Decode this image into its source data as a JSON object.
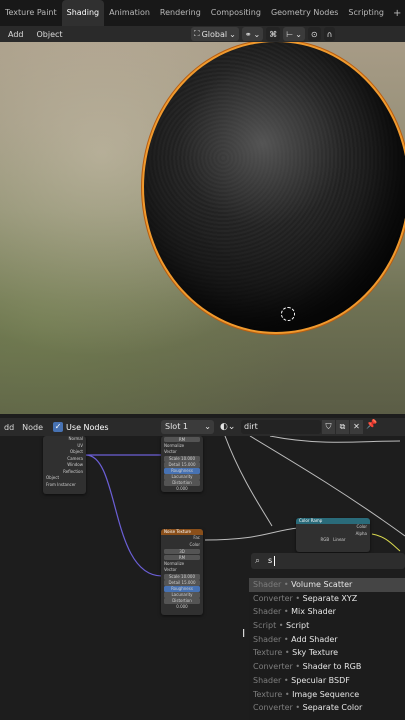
{
  "workspace_tabs": [
    {
      "label": "Texture Paint",
      "active": false
    },
    {
      "label": "Shading",
      "active": true
    },
    {
      "label": "Animation",
      "active": false
    },
    {
      "label": "Rendering",
      "active": false
    },
    {
      "label": "Compositing",
      "active": false
    },
    {
      "label": "Geometry Nodes",
      "active": false
    },
    {
      "label": "Scripting",
      "active": false
    }
  ],
  "add_tab_symbol": "+",
  "viewport_header": {
    "menus": [
      "Add",
      "Object"
    ],
    "orientation": "Global"
  },
  "node_editor_header": {
    "menus": [
      "dd",
      "Node"
    ],
    "use_nodes_label": "Use Nodes",
    "slot": "Slot 1",
    "material_name": "dirt"
  },
  "nodes": {
    "texcoord": {
      "outputs": [
        "Normal",
        "UV",
        "Object",
        "Camera",
        "Window",
        "Reflection"
      ],
      "object_label": "Object",
      "from_instancer": "From Instancer"
    },
    "noise_top": {
      "title": "RM",
      "normalize": "Normalize",
      "vector": "Vector",
      "fields": [
        "Scale 10.000",
        "Detail 15.000",
        "Roughness 0.800",
        "Lacunarity 2.000",
        "Distortion 0.000"
      ]
    },
    "voronoi": {
      "title": "Noise Texture",
      "outputs": [
        "Fac",
        "Color"
      ],
      "dims": "3D",
      "type": "RM",
      "normalize": "Normalize",
      "vector": "Vector",
      "fields": [
        "Scale 10.000",
        "Detail 15.000",
        "Roughness 0.800",
        "Lacunarity 2.000",
        "Distortion 0.000"
      ]
    },
    "colorramp": {
      "title": "Color Ramp",
      "outputs": [
        "Color",
        "Alpha"
      ],
      "mode": "RGB",
      "interp": "Linear"
    }
  },
  "search": {
    "query": "s"
  },
  "search_results": [
    {
      "category": "Shader",
      "name": "Volume Scatter",
      "highlighted": true
    },
    {
      "category": "Converter",
      "name": "Separate XYZ",
      "highlighted": false
    },
    {
      "category": "Shader",
      "name": "Mix Shader",
      "highlighted": false
    },
    {
      "category": "Script",
      "name": "Script",
      "highlighted": false
    },
    {
      "category": "Shader",
      "name": "Add Shader",
      "highlighted": false
    },
    {
      "category": "Texture",
      "name": "Sky Texture",
      "highlighted": false
    },
    {
      "category": "Converter",
      "name": "Shader to RGB",
      "highlighted": false
    },
    {
      "category": "Shader",
      "name": "Specular BSDF",
      "highlighted": false
    },
    {
      "category": "Texture",
      "name": "Image Sequence",
      "highlighted": false
    },
    {
      "category": "Converter",
      "name": "Separate Color",
      "highlighted": false
    }
  ],
  "colors": {
    "selection_outline": "#f09a2e",
    "accent_blue": "#4772b3",
    "texture_header": "#8a4f1a",
    "converter_header": "#2a6b7a",
    "link_purple": "#6b5fd6",
    "link_grey": "#bdbdbd",
    "link_yellow": "#d9d94f"
  }
}
